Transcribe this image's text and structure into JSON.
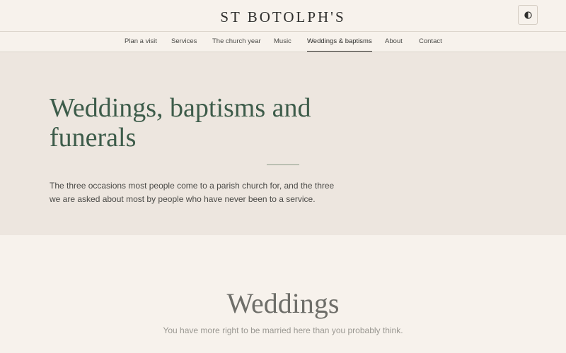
{
  "header": {
    "site_title": "ST BOTOLPH'S",
    "theme_toggle_icon": "half-circle-contrast-icon"
  },
  "nav": {
    "items": [
      {
        "label": "Plan a visit",
        "active": false
      },
      {
        "label": "Services",
        "active": false
      },
      {
        "label": "The church year",
        "active": false
      },
      {
        "label": "Music",
        "active": false
      },
      {
        "label": "Weddings & baptisms",
        "active": true
      },
      {
        "label": "About",
        "active": false
      },
      {
        "label": "Contact",
        "active": false
      }
    ]
  },
  "hero": {
    "title": "Weddings, baptisms and funerals",
    "intro": "The three occasions most people come to a parish church for, and the three we are asked about most by people who have never been to a service."
  },
  "weddings": {
    "title": "Weddings",
    "subtitle": "You have more right to be married here than you probably think."
  },
  "colors": {
    "page_background": "#f7f2ec",
    "hero_background": "#ede6df",
    "accent_green": "#3d5c4a",
    "text": "#3a3a38"
  }
}
